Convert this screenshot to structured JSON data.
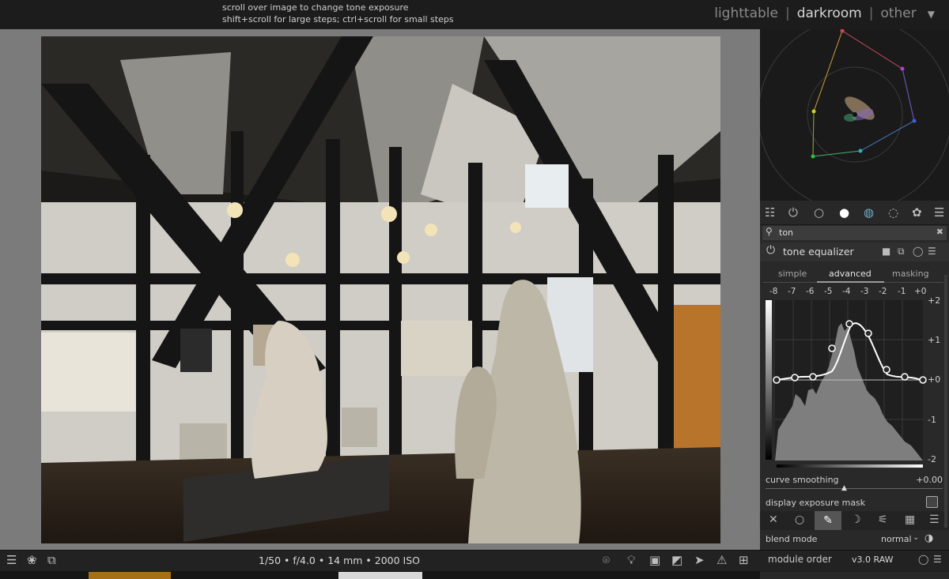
{
  "hints": {
    "line1": "scroll over image to change tone exposure",
    "line2": "shift+scroll for large steps; ctrl+scroll for small steps"
  },
  "views": {
    "lighttable": "lighttable",
    "darkroom": "darkroom",
    "other": "other",
    "separator": "|"
  },
  "bottom_toolbar": {
    "exif": "1/50 • f/4.0 • 14 mm • 2000 ISO"
  },
  "search": {
    "value": "ton"
  },
  "module": {
    "title": "tone equalizer",
    "tabs": [
      "simple",
      "advanced",
      "masking"
    ],
    "active_tab": "advanced",
    "ev_scale": [
      "-8",
      "-7",
      "-6",
      "-5",
      "-4",
      "-3",
      "-2",
      "-1",
      "+0"
    ],
    "y_labels": [
      "+2",
      "+1",
      "+0",
      "-1",
      "-2"
    ],
    "curve_smoothing_label": "curve smoothing",
    "curve_smoothing_value": "+0.00",
    "display_exposure_mask_label": "display exposure mask",
    "blend_mode_label": "blend mode",
    "blend_mode_value": "normal"
  },
  "right_bottom": {
    "module_order_label": "module order",
    "module_order_value": "v3.0 RAW"
  },
  "colors": {
    "accent": "#d0d0d0",
    "panel": "#292929",
    "center_bg": "#7b7b7b"
  }
}
